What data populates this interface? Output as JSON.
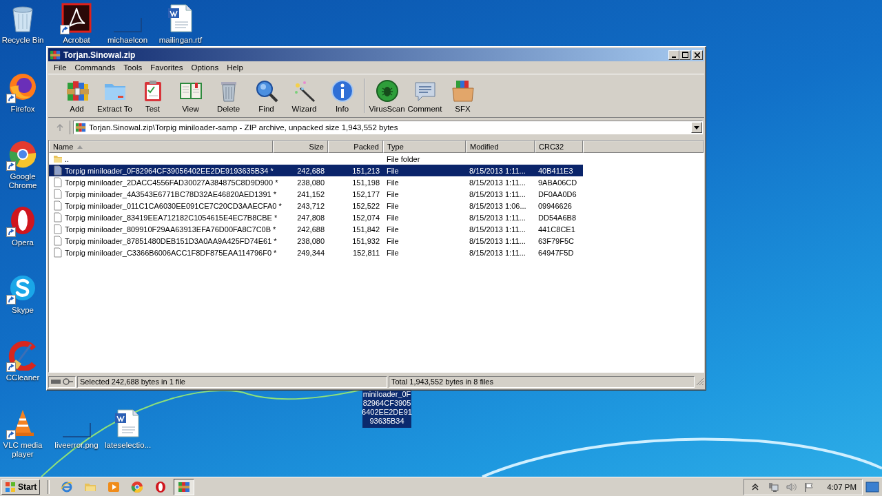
{
  "desktop_icons": [
    {
      "label": "Recycle Bin",
      "shortcut": false
    },
    {
      "label": "Acrobat",
      "shortcut": true
    },
    {
      "label": "michaelcon",
      "shortcut": false
    },
    {
      "label": "mailingan.rtf",
      "shortcut": false
    },
    {
      "label": "Firefox",
      "shortcut": true
    },
    {
      "label": "Google Chrome",
      "shortcut": true
    },
    {
      "label": "Opera",
      "shortcut": true
    },
    {
      "label": "Skype",
      "shortcut": true
    },
    {
      "label": "CCleaner",
      "shortcut": true
    },
    {
      "label": "VLC media player",
      "shortcut": true
    },
    {
      "label": "liveerror.png",
      "shortcut": false
    },
    {
      "label": "lateselectio...",
      "shortcut": false
    }
  ],
  "drag_label": {
    "lines": [
      "miniloader_0F",
      "82964CF3905",
      "6402EE2DE91",
      "93635B34"
    ]
  },
  "window": {
    "title": "Torjan.Sinowal.zip"
  },
  "menu": [
    "File",
    "Commands",
    "Tools",
    "Favorites",
    "Options",
    "Help"
  ],
  "toolbar_groups": [
    {
      "buttons": [
        "Add",
        "Extract To",
        "Test",
        "View",
        "Delete",
        "Find",
        "Wizard",
        "Info"
      ]
    },
    {
      "buttons": [
        "VirusScan",
        "Comment",
        "SFX"
      ]
    }
  ],
  "address": {
    "path": "Torjan.Sinowal.zip\\Torpig miniloader-samp - ZIP archive, unpacked size 1,943,552 bytes"
  },
  "file_list": {
    "columns": [
      {
        "label": "Name",
        "sorted": true
      },
      {
        "label": "Size",
        "sorted": false
      },
      {
        "label": "Packed",
        "sorted": false
      },
      {
        "label": "Type",
        "sorted": false
      },
      {
        "label": "Modified",
        "sorted": false
      },
      {
        "label": "CRC32",
        "sorted": false
      }
    ],
    "rows": [
      {
        "kind": "folder",
        "selected": false,
        "name": "..",
        "type": "File folder"
      },
      {
        "kind": "file",
        "selected": true,
        "name": "Torpig miniloader_0F82964CF39056402EE2DE9193635B34 *",
        "size": "242,688",
        "packed": "151,213",
        "type": "File",
        "modified": "8/15/2013 1:11...",
        "crc32": "40B411E3"
      },
      {
        "kind": "file",
        "selected": false,
        "name": "Torpig miniloader_2DACC4556FAD30027A384875C8D9D900 *",
        "size": "238,080",
        "packed": "151,198",
        "type": "File",
        "modified": "8/15/2013 1:11...",
        "crc32": "9ABA06CD"
      },
      {
        "kind": "file",
        "selected": false,
        "name": "Torpig miniloader_4A3543E6771BC78D32AE46820AED1391 *",
        "size": "241,152",
        "packed": "152,177",
        "type": "File",
        "modified": "8/15/2013 1:11...",
        "crc32": "DF0AA0D6"
      },
      {
        "kind": "file",
        "selected": false,
        "name": "Torpig miniloader_011C1CA6030EE091CE7C20CD3AAECFA0 *",
        "size": "243,712",
        "packed": "152,522",
        "type": "File",
        "modified": "8/15/2013 1:06...",
        "crc32": "09946626"
      },
      {
        "kind": "file",
        "selected": false,
        "name": "Torpig miniloader_83419EEA712182C1054615E4EC7B8CBE *",
        "size": "247,808",
        "packed": "152,074",
        "type": "File",
        "modified": "8/15/2013 1:11...",
        "crc32": "DD54A6B8"
      },
      {
        "kind": "file",
        "selected": false,
        "name": "Torpig miniloader_809910F29AA63913EFA76D00FA8C7C0B *",
        "size": "242,688",
        "packed": "151,842",
        "type": "File",
        "modified": "8/15/2013 1:11...",
        "crc32": "441C8CE1"
      },
      {
        "kind": "file",
        "selected": false,
        "name": "Torpig miniloader_87851480DEB151D3A0AA9A425FD74E61 *",
        "size": "238,080",
        "packed": "151,932",
        "type": "File",
        "modified": "8/15/2013 1:11...",
        "crc32": "63F79F5C"
      },
      {
        "kind": "file",
        "selected": false,
        "name": "Torpig miniloader_C3366B6006ACC1F8DF875EAA114796F0 *",
        "size": "249,344",
        "packed": "152,811",
        "type": "File",
        "modified": "8/15/2013 1:11...",
        "crc32": "64947F5D"
      }
    ]
  },
  "status_bar": {
    "selection": "Selected 242,688 bytes in 1 file",
    "total": "Total 1,943,552 bytes in 8 files"
  },
  "taskbar": {
    "start": "Start",
    "apps": [
      {
        "selected": false
      },
      {
        "selected": false
      },
      {
        "selected": false
      },
      {
        "selected": false
      },
      {
        "selected": false
      },
      {
        "selected": true
      }
    ],
    "clock": "4:07 PM"
  }
}
